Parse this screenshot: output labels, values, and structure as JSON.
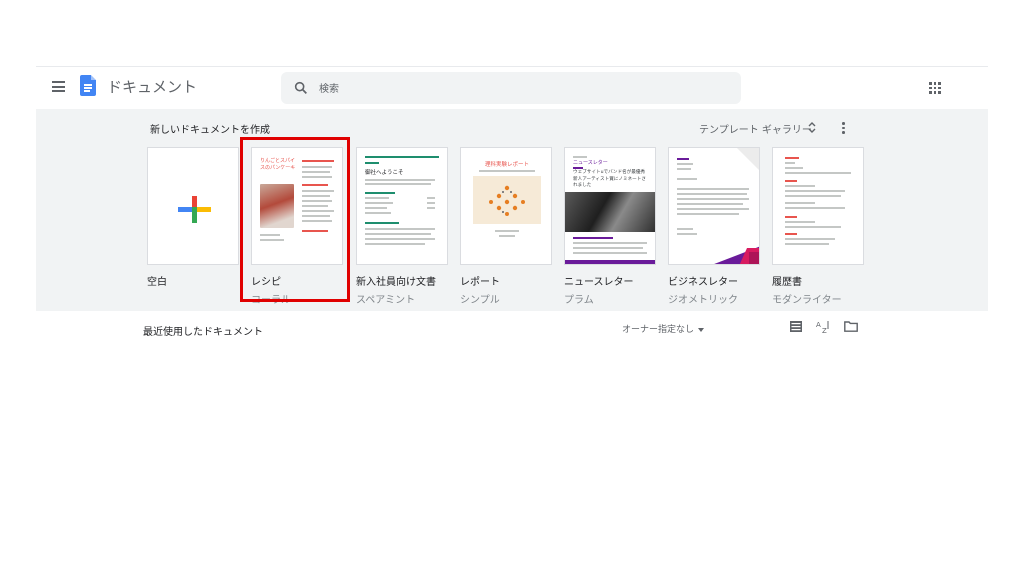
{
  "header": {
    "app_title": "ドキュメント",
    "search_placeholder": "検索"
  },
  "templates_section": {
    "title": "新しいドキュメントを作成",
    "gallery_label": "テンプレート ギャラリー",
    "templates": [
      {
        "name": "空白",
        "style": ""
      },
      {
        "name": "レシピ",
        "style": "コーラル",
        "thumb_title": "りんごとスパイスのパンケーキ"
      },
      {
        "name": "新入社員向け文書",
        "style": "スペアミント",
        "thumb_title": "御社へようこそ"
      },
      {
        "name": "レポート",
        "style": "シンプル",
        "thumb_title": "理科実験レポート"
      },
      {
        "name": "ニュースレター",
        "style": "プラム",
        "thumb_title": "ニュースレター",
        "thumb_body": "ウェブサイトuでバンド名が最優秀新人アーティスト賞にノミネートされました"
      },
      {
        "name": "ビジネスレター",
        "style": "ジオメトリック"
      },
      {
        "name": "履歴書",
        "style": "モダンライター"
      }
    ]
  },
  "recent": {
    "title": "最近使用したドキュメント",
    "owner_filter": "オーナー指定なし"
  },
  "colors": {
    "docs_blue": "#4285f4",
    "panel_bg": "#f1f3f4",
    "highlight": "#e00000",
    "coral": "#e8554e",
    "spearmint": "#1e8e6e",
    "plum": "#6a1b9a",
    "geometric": "#d81b60"
  }
}
